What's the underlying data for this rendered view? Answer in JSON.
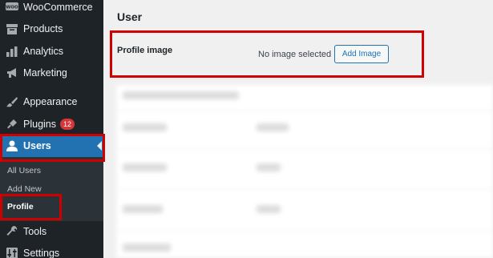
{
  "sidebar": {
    "items": [
      {
        "label": "WooCommerce",
        "icon": "woocommerce-icon"
      },
      {
        "label": "Products",
        "icon": "archive-icon"
      },
      {
        "label": "Analytics",
        "icon": "bar-chart-icon"
      },
      {
        "label": "Marketing",
        "icon": "megaphone-icon"
      },
      {
        "label": "Appearance",
        "icon": "paintbrush-icon"
      },
      {
        "label": "Plugins",
        "icon": "plug-icon",
        "badge": "12"
      },
      {
        "label": "Users",
        "icon": "user-icon",
        "active": true
      },
      {
        "label": "Tools",
        "icon": "wrench-icon"
      },
      {
        "label": "Settings",
        "icon": "sliders-icon"
      }
    ],
    "submenu": [
      {
        "label": "All Users"
      },
      {
        "label": "Add New"
      },
      {
        "label": "Profile",
        "current": true
      }
    ]
  },
  "main": {
    "title": "User",
    "profile_image": {
      "label": "Profile image",
      "status": "No image selected",
      "button": "Add Image"
    }
  },
  "colors": {
    "sidebar_bg": "#1d2327",
    "submenu_bg": "#2c3338",
    "active_bg": "#2271b1",
    "badge": "#d63638",
    "highlight": "#d00000"
  }
}
